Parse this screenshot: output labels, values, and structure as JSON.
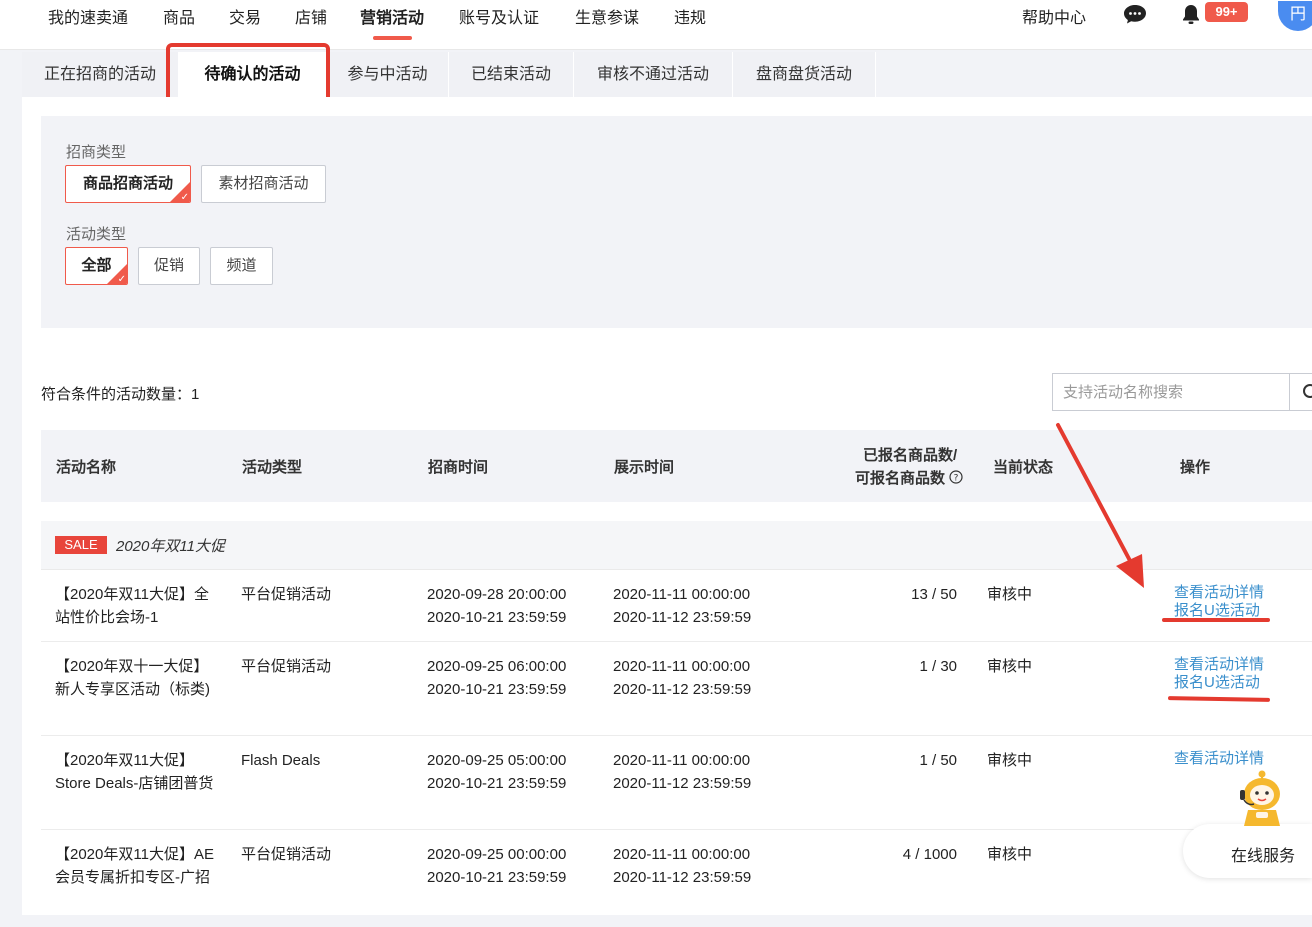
{
  "topnav": {
    "items": [
      "我的速卖通",
      "商品",
      "交易",
      "店铺",
      "营销活动",
      "账号及认证",
      "生意参谋",
      "违规"
    ],
    "active_index": 4,
    "help": "帮助中心",
    "badge": "99+",
    "avatar_char": "円",
    "icons": [
      "chat-bubble-icon",
      "bell-icon"
    ]
  },
  "tabs": [
    "正在招商的活动",
    "待确认的活动",
    "参与中活动",
    "已结束活动",
    "审核不通过活动",
    "盘商盘货活动"
  ],
  "active_tab": 1,
  "filters": {
    "recruit_label": "招商类型",
    "recruit_options": [
      "商品招商活动",
      "素材招商活动"
    ],
    "activity_label": "活动类型",
    "activity_options": [
      "全部",
      "促销",
      "频道"
    ]
  },
  "result_count": "符合条件的活动数量：1",
  "search": {
    "placeholder": "支持活动名称搜索",
    "icon": "search-icon"
  },
  "table": {
    "headers": {
      "name": "活动名称",
      "type": "活动类型",
      "recruit_time": "招商时间",
      "show_time": "展示时间",
      "count_line1": "已报名商品数/",
      "count_line2": "可报名商品数",
      "status": "当前状态",
      "ops": "操作"
    },
    "group": {
      "badge": "SALE",
      "title": "2020年双11大促"
    },
    "rows": [
      {
        "name": "【2020年双11大促】全站性价比会场-1",
        "type": "平台促销活动",
        "recruit_start": "2020-09-28 20:00:00",
        "recruit_end": "2020-10-21 23:59:59",
        "show_start": "2020-11-11 00:00:00",
        "show_end": "2020-11-12 23:59:59",
        "count": "13 / 50",
        "status": "审核中",
        "op1": "查看活动详情",
        "op2": "报名U选活动"
      },
      {
        "name": "【2020年双十一大促】新人专享区活动（标类)",
        "type": "平台促销活动",
        "recruit_start": "2020-09-25 06:00:00",
        "recruit_end": "2020-10-21 23:59:59",
        "show_start": "2020-11-11 00:00:00",
        "show_end": "2020-11-12 23:59:59",
        "count": "1 / 30",
        "status": "审核中",
        "op1": "查看活动详情",
        "op2": "报名U选活动"
      },
      {
        "name": "【2020年双11大促】Store Deals-店铺团普货",
        "type": "Flash Deals",
        "recruit_start": "2020-09-25 05:00:00",
        "recruit_end": "2020-10-21 23:59:59",
        "show_start": "2020-11-11 00:00:00",
        "show_end": "2020-11-12 23:59:59",
        "count": "1 / 50",
        "status": "审核中",
        "op1": "查看活动详情"
      },
      {
        "name": "【2020年双11大促】AE会员专属折扣专区-广招",
        "type": "平台促销活动",
        "recruit_start": "2020-09-25 00:00:00",
        "recruit_end": "2020-10-21 23:59:59",
        "show_start": "2020-11-11 00:00:00",
        "show_end": "2020-11-12 23:59:59",
        "count": "4 / 1000",
        "status": "审核中"
      }
    ]
  },
  "service": {
    "label": "在线服务"
  },
  "colors": {
    "accent": "#f05a4b",
    "annotation": "#e43a2f",
    "link": "#3a8fcc"
  }
}
